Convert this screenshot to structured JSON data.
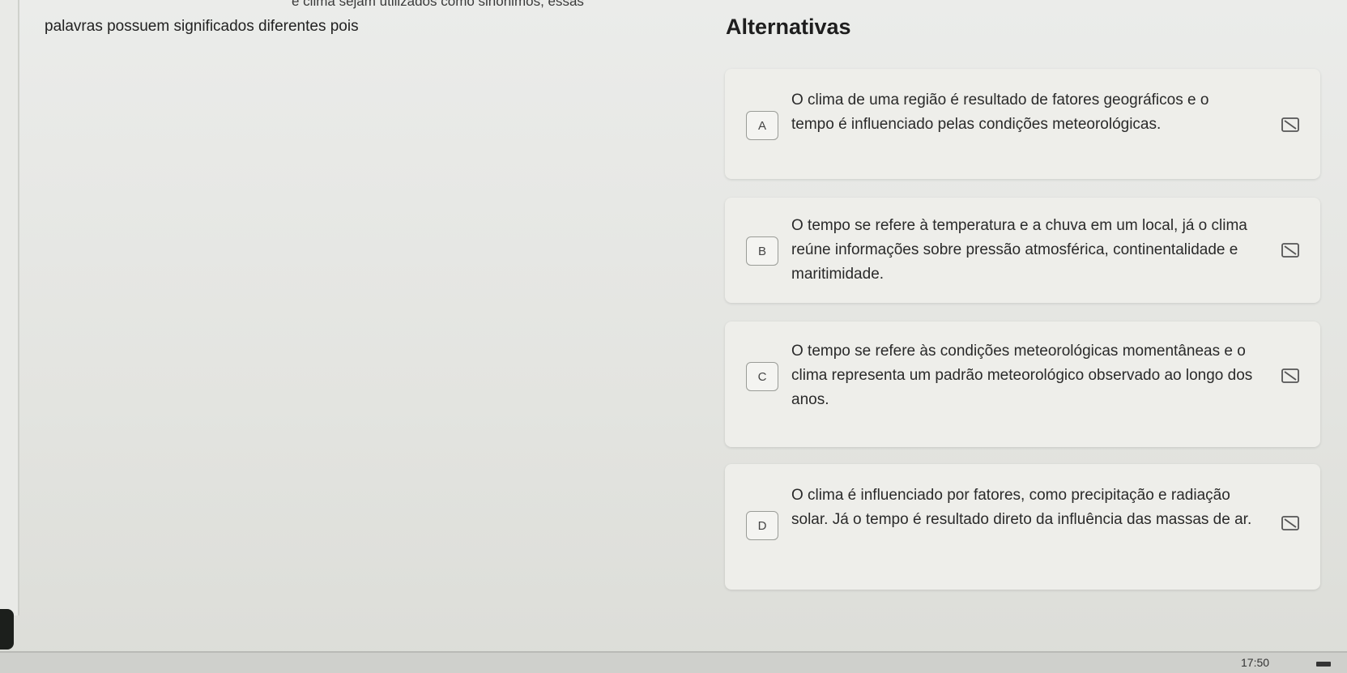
{
  "question": {
    "top_cut_text": "e clima sejam utilizados como sinônimos, essas",
    "text": "palavras possuem significados diferentes pois"
  },
  "alternatives": {
    "heading": "Alternativas",
    "options": [
      {
        "letter": "A",
        "text": "O clima de uma região é resultado de fatores geográficos e o tempo é influenciado pelas condições meteorológicas."
      },
      {
        "letter": "B",
        "text": "O tempo se refere à temperatura e a chuva em um local, já o clima reúne informações sobre pressão atmosférica, continentalidade e maritimidade."
      },
      {
        "letter": "C",
        "text": "O tempo se refere às condições meteorológicas momentâneas e o clima representa um padrão meteorológico observado ao longo dos anos."
      },
      {
        "letter": "D",
        "text": "O clima é influenciado por fatores, como precipitação e radiação solar. Já o tempo é resultado direto da influência das massas de ar."
      }
    ],
    "strike_icon": "strikethrough-icon"
  },
  "taskbar": {
    "time": "17:50"
  }
}
